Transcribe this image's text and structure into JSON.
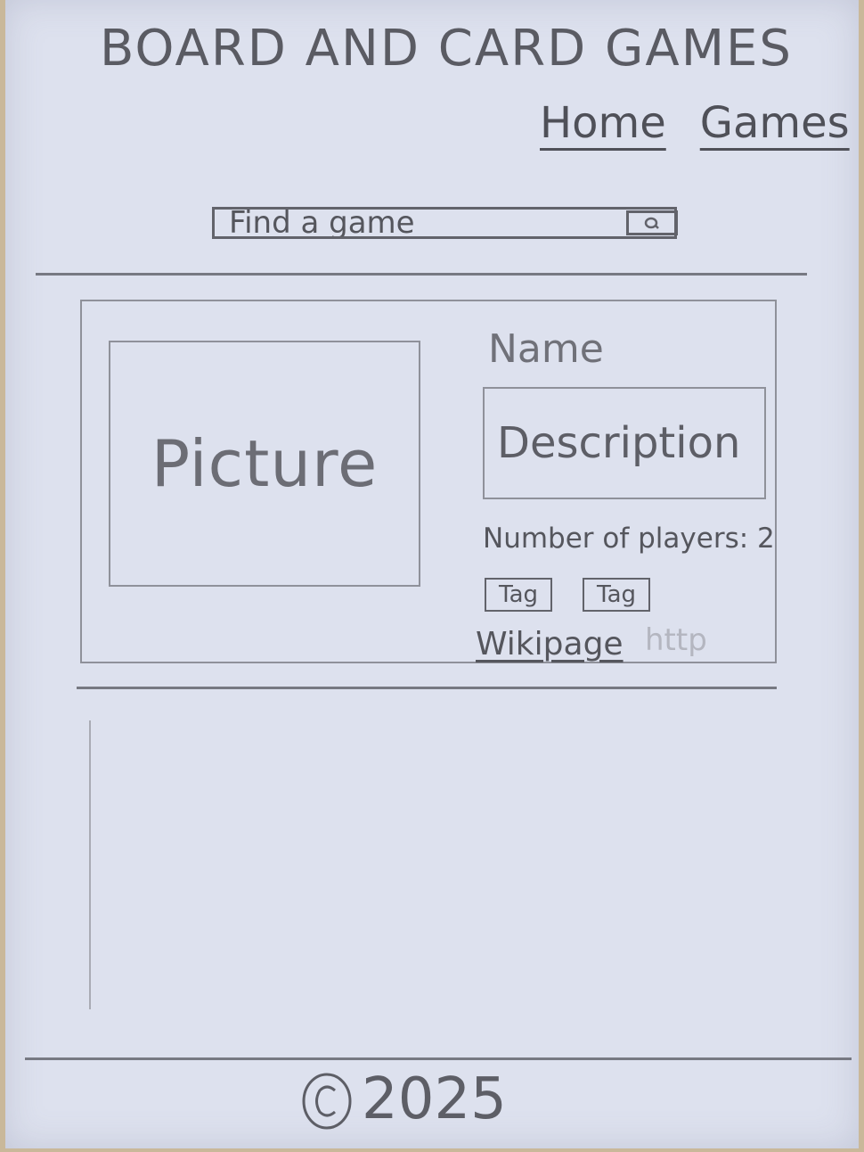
{
  "header": {
    "title": "BOARD AND CARD GAMES",
    "nav": [
      {
        "label": "Home"
      },
      {
        "label": "Games"
      }
    ]
  },
  "search": {
    "placeholder": "Find a game",
    "button_icon": "search-icon"
  },
  "game_card": {
    "picture_label": "Picture",
    "name": "Name",
    "description": "Description",
    "players": "Number of players: 2",
    "tags": [
      "Tag",
      "Tag"
    ],
    "wiki_link": "Wikipage",
    "wiki_ghost": "http"
  },
  "footer": {
    "copyright_year": "2025"
  }
}
